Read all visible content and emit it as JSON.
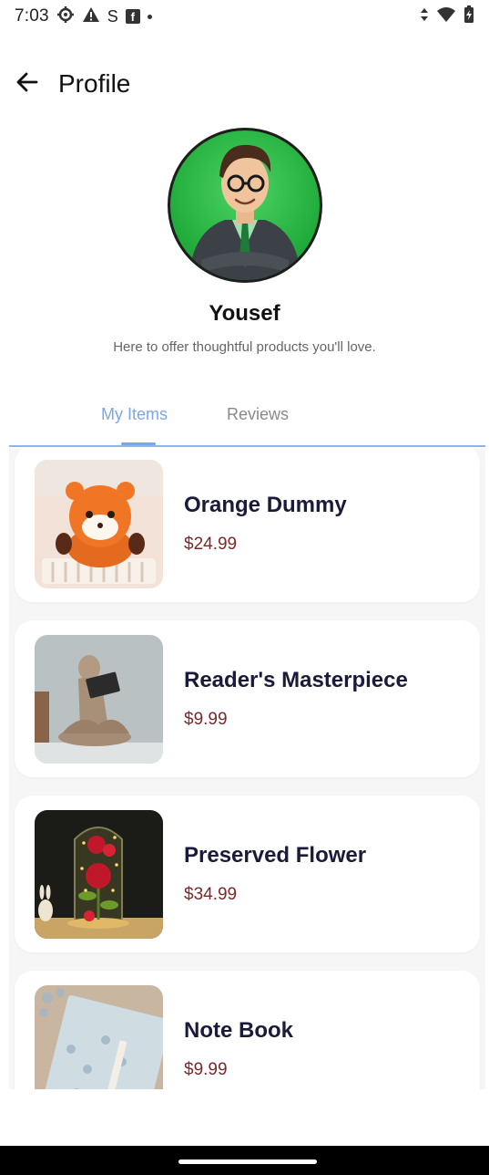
{
  "status_bar": {
    "time": "7:03",
    "left_icons": [
      "gear-icon",
      "warning-icon",
      "s-icon",
      "facebook-icon",
      "dot-icon"
    ],
    "right_icons": [
      "data-arrows-icon",
      "wifi-icon",
      "battery-icon"
    ],
    "s_glyph": "S",
    "fb_glyph": "f"
  },
  "app_bar": {
    "back_icon": "arrow-left-icon",
    "title": "Profile"
  },
  "profile": {
    "name": "Yousef",
    "bio": "Here to offer thoughtful products you'll love."
  },
  "tabs": [
    {
      "label": "My Items",
      "active": true
    },
    {
      "label": "Reviews",
      "active": false
    }
  ],
  "colors": {
    "accent": "#7aa7ea",
    "price": "#7a2a2a",
    "title": "#1a1a3a"
  },
  "items": [
    {
      "title": "Orange Dummy",
      "price": "$24.99"
    },
    {
      "title": "Reader's Masterpiece",
      "price": "$9.99"
    },
    {
      "title": "Preserved Flower",
      "price": "$34.99"
    },
    {
      "title": "Note Book",
      "price": "$9.99"
    }
  ]
}
